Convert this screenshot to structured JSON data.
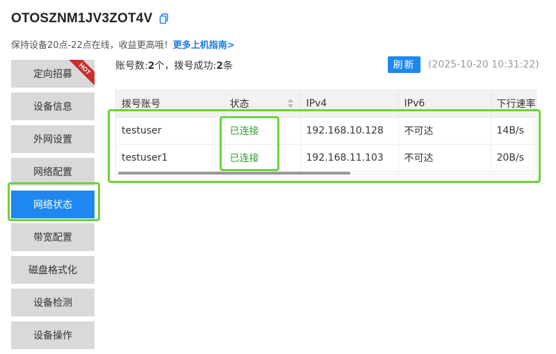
{
  "header": {
    "device_id": "OTOSZNM1JV3ZOT4V",
    "copy_icon": "copy-icon"
  },
  "tip": {
    "text": "保持设备20点-22点在线，收益更高哦！",
    "link": "更多上机指南>"
  },
  "sidebar": {
    "items": [
      {
        "label": "定向招募",
        "badge": "HOT"
      },
      {
        "label": "设备信息"
      },
      {
        "label": "外网设置"
      },
      {
        "label": "网络配置"
      },
      {
        "label": "网络状态",
        "active": true
      },
      {
        "label": "带宽配置"
      },
      {
        "label": "磁盘格式化"
      },
      {
        "label": "设备检测"
      },
      {
        "label": "设备操作"
      }
    ]
  },
  "summary": {
    "count_label": "账号数:",
    "count_value": "2",
    "count_unit": "个，拨号成功:",
    "success_value": "2",
    "success_unit": "条"
  },
  "refresh": {
    "label": "刷新",
    "timestamp": "(2025-10-20 10:31:22)"
  },
  "table": {
    "columns": [
      "拨号账号",
      "状态",
      "IPv4",
      "IPv6",
      "下行速率"
    ],
    "rows": [
      {
        "account": "testuser",
        "status": "已连接",
        "ipv4": "192.168.10.128",
        "ipv6": "不可达",
        "down": "14B/s"
      },
      {
        "account": "testuser1",
        "status": "已连接",
        "ipv4": "192.168.11.103",
        "ipv6": "不可达",
        "down": "20B/s"
      }
    ]
  },
  "colors": {
    "accent": "#1e87f0",
    "sidebar_bg": "#d9d9d9",
    "status_ok": "#2e9f2e",
    "highlight": "#6bd33a",
    "hot_badge": "#c9302c"
  }
}
